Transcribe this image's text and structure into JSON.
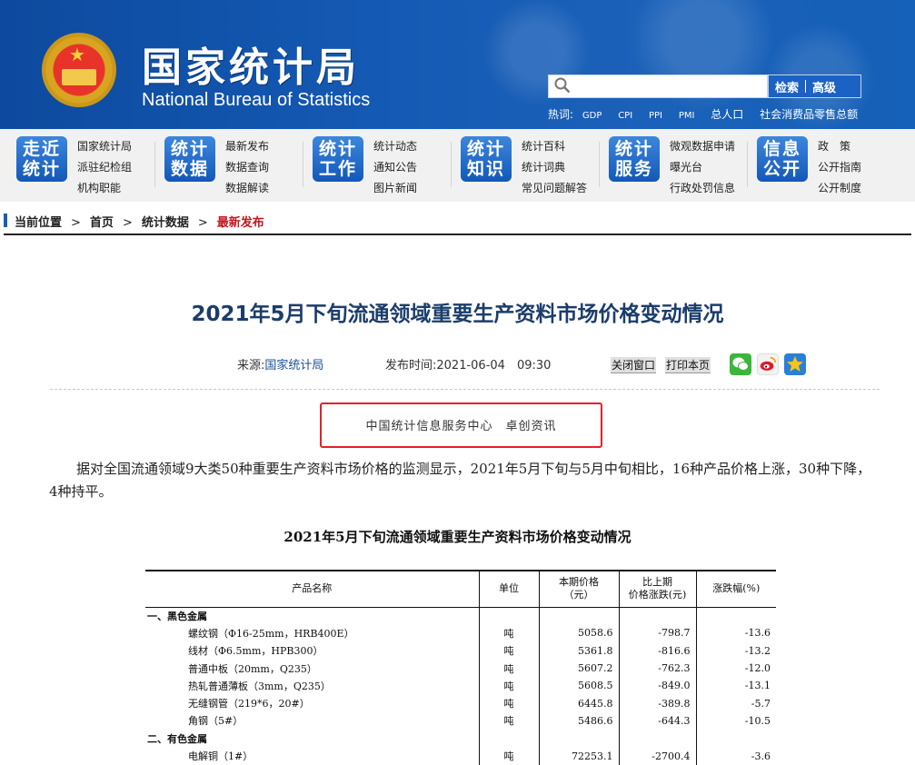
{
  "header": {
    "title_cn": "国家统计局",
    "title_en": "National Bureau of Statistics",
    "search": {
      "placeholder": "",
      "btn_search": "检索",
      "btn_advanced": "高级"
    },
    "hotwords_label": "热词:",
    "hotwords": [
      "GDP",
      "CPI",
      "PPI",
      "PMI",
      "总人口",
      "社会消费品零售总额"
    ]
  },
  "catnav": [
    {
      "block": [
        "走近",
        "统计"
      ],
      "links": [
        "国家统计局",
        "派驻纪检组",
        "机构职能"
      ]
    },
    {
      "block": [
        "统计",
        "数据"
      ],
      "links": [
        "最新发布",
        "数据查询",
        "数据解读"
      ]
    },
    {
      "block": [
        "统计",
        "工作"
      ],
      "links": [
        "统计动态",
        "通知公告",
        "图片新闻"
      ]
    },
    {
      "block": [
        "统计",
        "知识"
      ],
      "links": [
        "统计百科",
        "统计词典",
        "常见问题解答"
      ]
    },
    {
      "block": [
        "统计",
        "服务"
      ],
      "links": [
        "微观数据申请",
        "曝光台",
        "行政处罚信息"
      ]
    },
    {
      "block": [
        "信息",
        "公开"
      ],
      "links": [
        "政　策",
        "公开指南",
        "公开制度"
      ]
    }
  ],
  "breadcrumb": [
    "当前位置",
    "首页",
    "统计数据",
    "最新发布"
  ],
  "article": {
    "title": "2021年5月下旬流通领域重要生产资料市场价格变动情况",
    "source_label": "来源:",
    "source": "国家统计局",
    "time_label": "发布时间:",
    "time": "2021-06-04　09:30",
    "close_btn": "关闭窗口",
    "print_btn": "打印本页",
    "highlight": "中国统计信息服务中心　卓创资讯",
    "paragraph": "据对全国流通领域9大类50种重要生产资料市场价格的监测显示，2021年5月下旬与5月中旬相比，16种产品价格上涨，30种下降，4种持平。",
    "table_title": "2021年5月下旬流通领域重要生产资料市场价格变动情况"
  },
  "table": {
    "headers": [
      "产品名称",
      "单位",
      "本期价格\n（元）",
      "比上期\n价格涨跌(元)",
      "涨跌幅(%)"
    ],
    "rows": [
      {
        "type": "cat",
        "name": "一、黑色金属"
      },
      {
        "type": "item",
        "name": "螺纹钢（Φ16-25mm，HRB400E）",
        "unit": "吨",
        "price": "5058.6",
        "change": "-798.7",
        "pct": "-13.6"
      },
      {
        "type": "item",
        "name": "线材（Φ6.5mm，HPB300）",
        "unit": "吨",
        "price": "5361.8",
        "change": "-816.6",
        "pct": "-13.2"
      },
      {
        "type": "item",
        "name": "普通中板（20mm，Q235）",
        "unit": "吨",
        "price": "5607.2",
        "change": "-762.3",
        "pct": "-12.0"
      },
      {
        "type": "item",
        "name": "热轧普通薄板（3mm，Q235）",
        "unit": "吨",
        "price": "5608.5",
        "change": "-849.0",
        "pct": "-13.1"
      },
      {
        "type": "item",
        "name": "无缝钢管（219*6，20#）",
        "unit": "吨",
        "price": "6445.8",
        "change": "-389.8",
        "pct": "-5.7"
      },
      {
        "type": "item",
        "name": "角钢（5#）",
        "unit": "吨",
        "price": "5486.6",
        "change": "-644.3",
        "pct": "-10.5"
      },
      {
        "type": "cat",
        "name": "二、有色金属"
      },
      {
        "type": "item",
        "name": "电解铜（1#）",
        "unit": "吨",
        "price": "72253.1",
        "change": "-2700.4",
        "pct": "-3.6"
      }
    ]
  },
  "colors": {
    "banner": "#1459b3",
    "accent_red": "#c4161c",
    "title": "#1b3d6b"
  }
}
